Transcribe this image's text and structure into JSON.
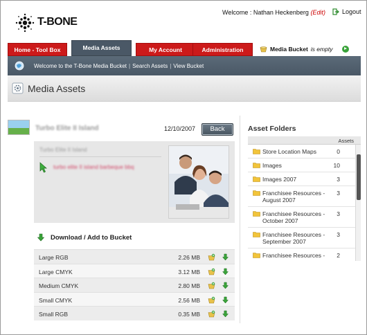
{
  "header": {
    "logo_text": "T-BONE",
    "welcome_label": "Welcome : ",
    "user_name": "Nathan Heckenberg",
    "edit_label": "(Edit)",
    "logout_label": "Logout"
  },
  "tabs": [
    {
      "label": "Home - Tool Box",
      "active": false
    },
    {
      "label": "Media Assets",
      "active": true
    },
    {
      "label": "My Account",
      "active": false
    },
    {
      "label": "Administration",
      "active": false
    }
  ],
  "bucket": {
    "label": "Media Bucket",
    "status": "is empty"
  },
  "subnav": {
    "welcome_link": "Welcome to the T-Bone Media Bucket",
    "separator": "|",
    "search_link": "Search Assets",
    "view_link": "View Bucket"
  },
  "page": {
    "title": "Media Assets"
  },
  "asset": {
    "name": "Turbo Elite II Island",
    "date": "12/10/2007",
    "back_label": "Back",
    "detail_title": "Turbo Elite II Island",
    "tags": "turbo elite II island barbeque bbq"
  },
  "download": {
    "heading": "Download / Add to Bucket",
    "rows": [
      {
        "name": "Large RGB",
        "size": "2.26 MB"
      },
      {
        "name": "Large CMYK",
        "size": "3.12 MB"
      },
      {
        "name": "Medium CMYK",
        "size": "2.80 MB"
      },
      {
        "name": "Small CMYK",
        "size": "2.56 MB"
      },
      {
        "name": "Small RGB",
        "size": "0.35 MB"
      }
    ]
  },
  "asset_folders": {
    "title": "Asset Folders",
    "column_assets": "Assets",
    "folders": [
      {
        "name": "Store Location Maps",
        "count": "0"
      },
      {
        "name": "Images",
        "count": "10"
      },
      {
        "name": "Images 2007",
        "count": "3"
      },
      {
        "name": "Franchisee Resources - August 2007",
        "count": "3"
      },
      {
        "name": "Franchisee Resources - October 2007",
        "count": "3"
      },
      {
        "name": "Franchisee Resources - September 2007",
        "count": "3"
      },
      {
        "name": "Franchisee Resources -",
        "count": "2"
      }
    ]
  },
  "colors": {
    "tab_red": "#cc1a1a",
    "tab_active": "#4a5866",
    "subnav_bg": "#4a5866",
    "edit_red": "#cc0000"
  }
}
